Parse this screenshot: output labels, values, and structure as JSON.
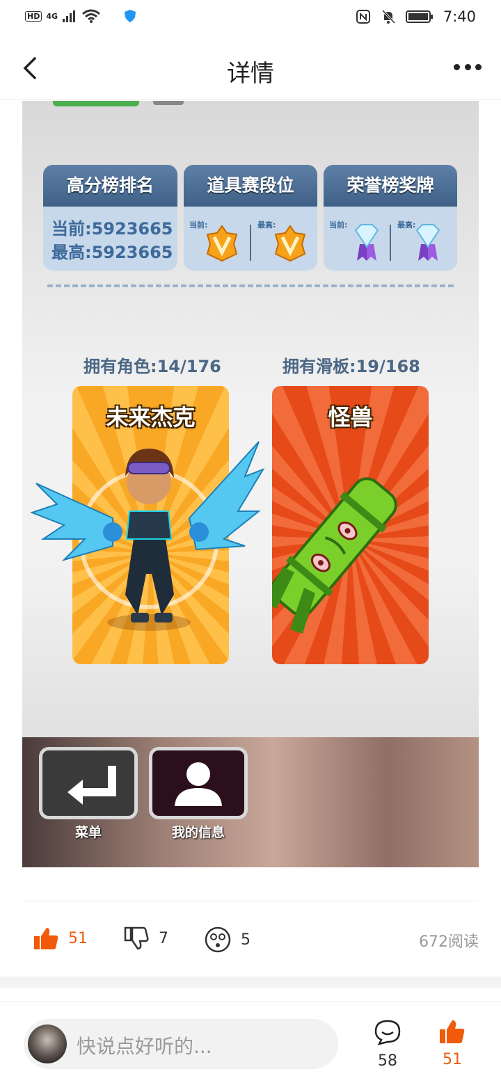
{
  "status_bar": {
    "network": "4G",
    "time": "7:40"
  },
  "nav": {
    "title": "详情"
  },
  "game": {
    "panels": {
      "rank_title": "高分榜排名",
      "rank_current": "当前:5923665",
      "rank_best": "最高:5923665",
      "prop_title": "道具赛段位",
      "honor_title": "荣誉榜奖牌",
      "current_label": "当前:",
      "best_label": "最高:"
    },
    "own_characters": "拥有角色:14/176",
    "own_boards": "拥有滑板:19/168",
    "character_name": "未来杰克",
    "board_name": "怪兽",
    "menu_label": "菜单",
    "info_label": "我的信息"
  },
  "actions": {
    "likes": "51",
    "dislikes": "7",
    "wow": "5",
    "reads": "672阅读"
  },
  "bottom_bar": {
    "placeholder": "快说点好听的...",
    "comments": "58",
    "likes": "51"
  },
  "colors": {
    "accent": "#f05a0a"
  }
}
